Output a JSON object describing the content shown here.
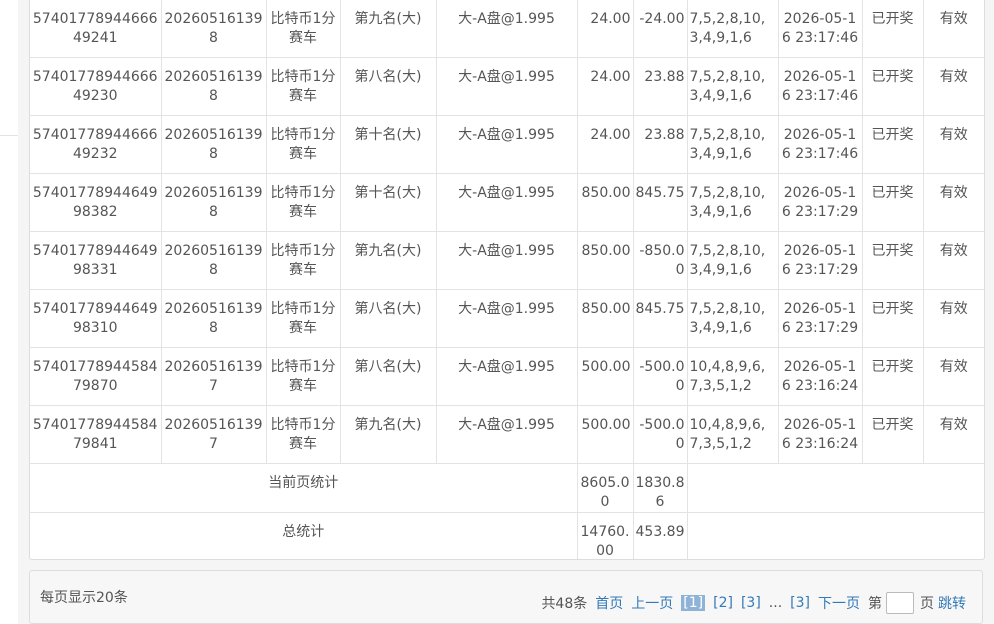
{
  "rows": [
    {
      "order_no": "5740177894466649241",
      "issue": "202605161398",
      "lottery": "比特币1分赛车",
      "position": "第九名(大)",
      "play": "大-A盘@1.995",
      "amount": "24.00",
      "win": "-24.00",
      "result": "7,5,2,8,10,3,4,9,1,6",
      "time": "2026-05-16 23:17:46",
      "status": "已开奖",
      "valid": "有效"
    },
    {
      "order_no": "5740177894466649230",
      "issue": "202605161398",
      "lottery": "比特币1分赛车",
      "position": "第八名(大)",
      "play": "大-A盘@1.995",
      "amount": "24.00",
      "win": "23.88",
      "result": "7,5,2,8,10,3,4,9,1,6",
      "time": "2026-05-16 23:17:46",
      "status": "已开奖",
      "valid": "有效"
    },
    {
      "order_no": "5740177894466649232",
      "issue": "202605161398",
      "lottery": "比特币1分赛车",
      "position": "第十名(大)",
      "play": "大-A盘@1.995",
      "amount": "24.00",
      "win": "23.88",
      "result": "7,5,2,8,10,3,4,9,1,6",
      "time": "2026-05-16 23:17:46",
      "status": "已开奖",
      "valid": "有效"
    },
    {
      "order_no": "5740177894464998382",
      "issue": "202605161398",
      "lottery": "比特币1分赛车",
      "position": "第十名(大)",
      "play": "大-A盘@1.995",
      "amount": "850.00",
      "win": "845.75",
      "result": "7,5,2,8,10,3,4,9,1,6",
      "time": "2026-05-16 23:17:29",
      "status": "已开奖",
      "valid": "有效"
    },
    {
      "order_no": "5740177894464998331",
      "issue": "202605161398",
      "lottery": "比特币1分赛车",
      "position": "第九名(大)",
      "play": "大-A盘@1.995",
      "amount": "850.00",
      "win": "-850.00",
      "result": "7,5,2,8,10,3,4,9,1,6",
      "time": "2026-05-16 23:17:29",
      "status": "已开奖",
      "valid": "有效"
    },
    {
      "order_no": "5740177894464998310",
      "issue": "202605161398",
      "lottery": "比特币1分赛车",
      "position": "第八名(大)",
      "play": "大-A盘@1.995",
      "amount": "850.00",
      "win": "845.75",
      "result": "7,5,2,8,10,3,4,9,1,6",
      "time": "2026-05-16 23:17:29",
      "status": "已开奖",
      "valid": "有效"
    },
    {
      "order_no": "5740177894458479870",
      "issue": "202605161397",
      "lottery": "比特币1分赛车",
      "position": "第八名(大)",
      "play": "大-A盘@1.995",
      "amount": "500.00",
      "win": "-500.00",
      "result": "10,4,8,9,6,7,3,5,1,2",
      "time": "2026-05-16 23:16:24",
      "status": "已开奖",
      "valid": "有效"
    },
    {
      "order_no": "5740177894458479841",
      "issue": "202605161397",
      "lottery": "比特币1分赛车",
      "position": "第九名(大)",
      "play": "大-A盘@1.995",
      "amount": "500.00",
      "win": "-500.00",
      "result": "10,4,8,9,6,7,3,5,1,2",
      "time": "2026-05-16 23:16:24",
      "status": "已开奖",
      "valid": "有效"
    }
  ],
  "summary": {
    "page_label": "当前页统计",
    "page_amount": "8605.00",
    "page_win": "1830.86",
    "total_label": "总统计",
    "total_amount": "14760.00",
    "total_win": "453.89"
  },
  "pagination": {
    "per_page_text": "每页显示20条",
    "total_text": "共48条",
    "first": "首页",
    "prev": "上一页",
    "pages": [
      "[1]",
      "[2]",
      "[3]",
      "...",
      "[3]"
    ],
    "current": "[1]",
    "next": "下一页",
    "goto_prefix": "第",
    "goto_suffix": "页",
    "jump": "跳转",
    "goto_value": ""
  },
  "colors": {
    "link": "#337ab7",
    "current_page_bg": "#8fb3d6",
    "border": "#e3e3e3"
  }
}
